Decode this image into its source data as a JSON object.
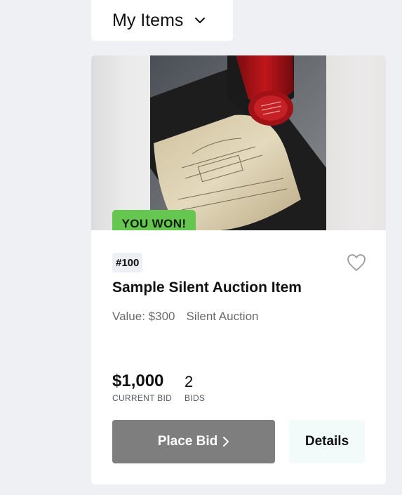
{
  "filter": {
    "label": "My Items",
    "icon": "chevron-down-icon"
  },
  "item": {
    "status_badge": "YOU WON!",
    "status_color": "#66c750",
    "lot_number": "#100",
    "favorite_icon": "heart-outline-icon",
    "title": "Sample Silent Auction Item",
    "value": "Value: $300",
    "auction_type": "Silent Auction",
    "current_bid": "$1,000",
    "current_bid_label": "CURRENT BID",
    "bid_count": "2",
    "bid_count_label": "BIDS",
    "place_bid_label": "Place Bid",
    "place_bid_icon": "chevron-right-icon",
    "details_label": "Details"
  },
  "colors": {
    "page_background": "#eef0f4",
    "place_bid_button": "#7e7e7e",
    "details_button": "#f2fbfa"
  }
}
